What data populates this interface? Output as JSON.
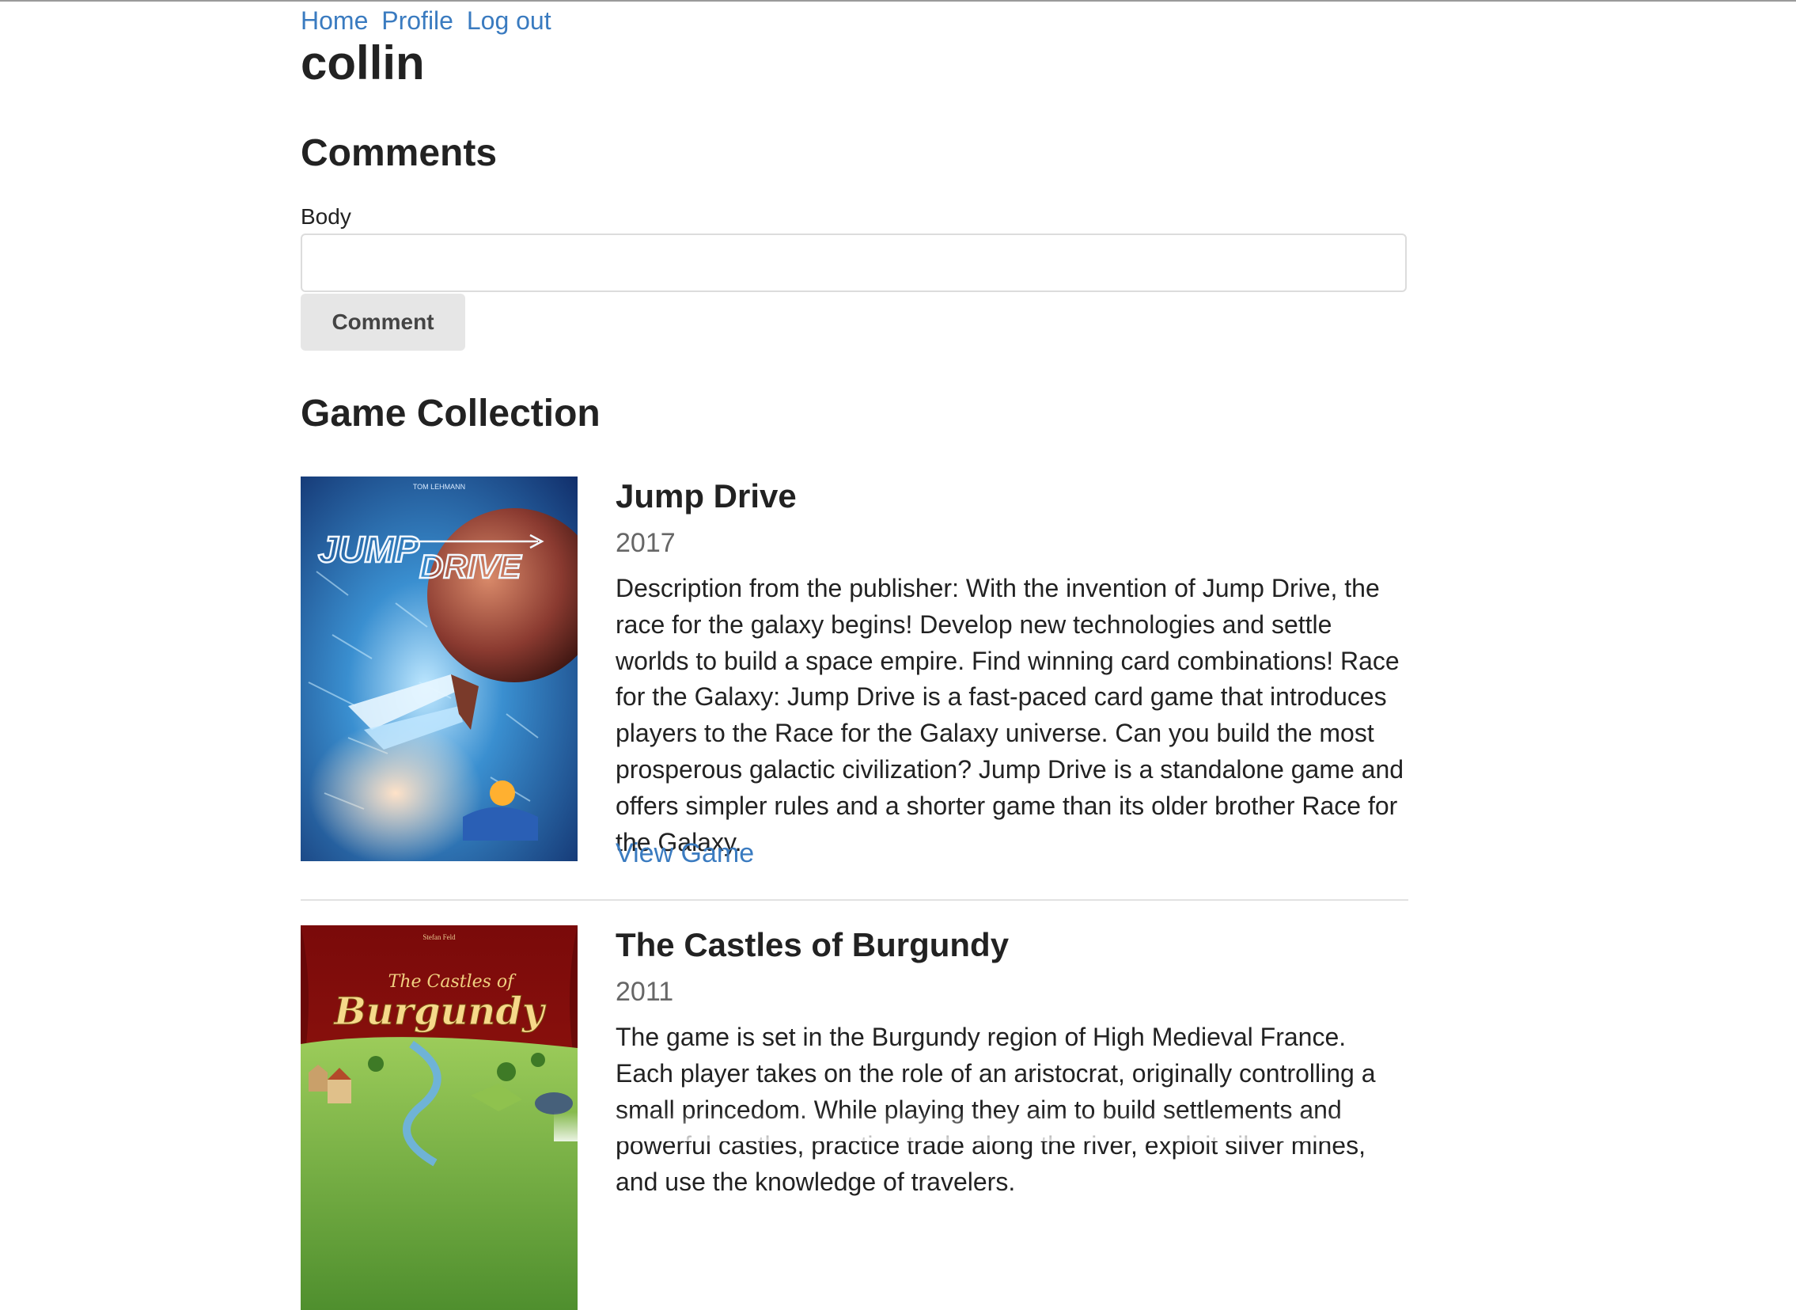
{
  "nav": {
    "home": "Home",
    "profile": "Profile",
    "logout": "Log out"
  },
  "user": {
    "name": "collin"
  },
  "comments": {
    "title": "Comments",
    "body_label": "Body",
    "body_value": "",
    "submit_label": "Comment"
  },
  "collection": {
    "title": "Game Collection",
    "games": [
      {
        "title": "Jump Drive",
        "year": "2017",
        "cover_text": "JUMP DRIVE",
        "description": "Description from the publisher: With the invention of Jump Drive, the race for the galaxy begins! Develop new technologies and settle worlds to build a space empire. Find winning card combinations! Race for the Galaxy: Jump Drive is a fast-paced card game that introduces players to the Race for the Galaxy universe. Can you build the most prosperous galactic civilization? Jump Drive is a standalone game and offers simpler rules and a shorter game than its older brother Race for the Galaxy.",
        "link": "View Game"
      },
      {
        "title": "The Castles of Burgundy",
        "year": "2011",
        "cover_text_small": "The Castles of",
        "cover_text_large": "Burgundy",
        "description": "The game is set in the Burgundy region of High Medieval France. Each player takes on the role of an aristocrat, originally controlling a small princedom. While playing they aim to build settlements and powerful castles, practice trade along the river, exploit silver mines, and use the knowledge of travelers."
      }
    ]
  },
  "colors": {
    "link": "#3a7bc0",
    "text": "#222222",
    "muted": "#666666",
    "button_bg": "#e6e6e6"
  }
}
